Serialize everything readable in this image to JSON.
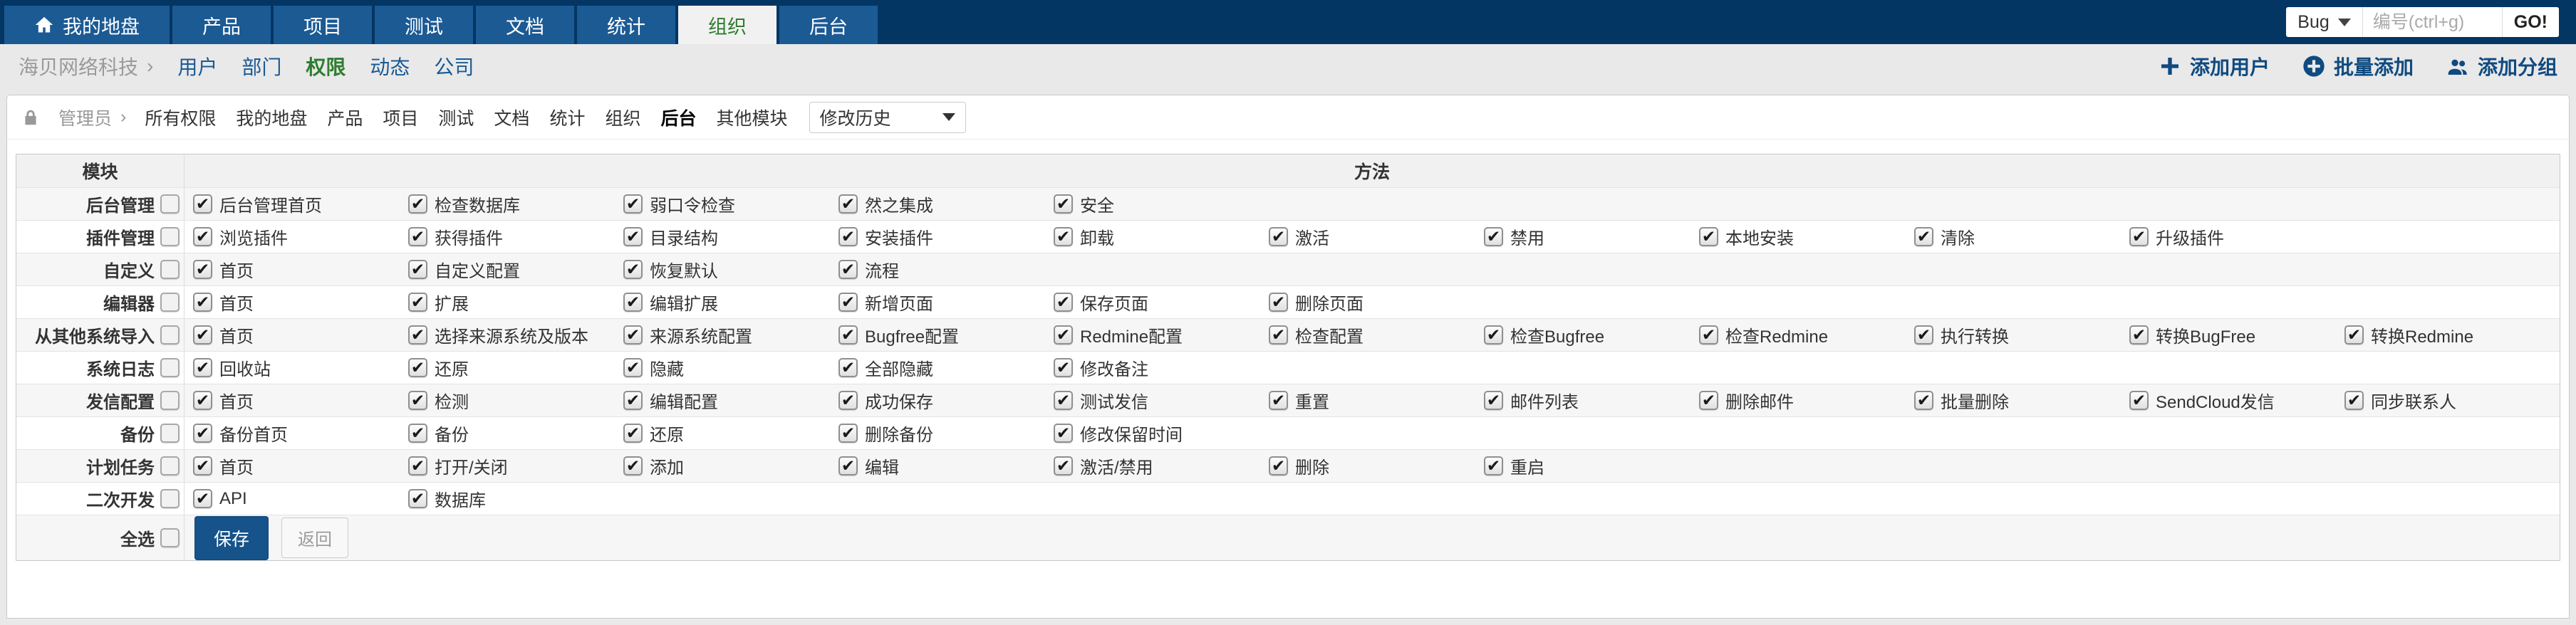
{
  "navbar": {
    "tabs": [
      {
        "id": "my-dashboard",
        "label": "我的地盘",
        "icon": "home",
        "active": false
      },
      {
        "id": "product",
        "label": "产品",
        "active": false
      },
      {
        "id": "project",
        "label": "项目",
        "active": false
      },
      {
        "id": "test",
        "label": "测试",
        "active": false
      },
      {
        "id": "doc",
        "label": "文档",
        "active": false
      },
      {
        "id": "stats",
        "label": "统计",
        "active": false
      },
      {
        "id": "organization",
        "label": "组织",
        "active": true
      },
      {
        "id": "admin",
        "label": "后台",
        "active": false
      }
    ],
    "search": {
      "category": "Bug",
      "placeholder": "编号(ctrl+g)",
      "go": "GO!"
    }
  },
  "submenu": {
    "company": "海贝网络科技",
    "separator": "›",
    "items": [
      {
        "id": "user",
        "label": "用户",
        "active": false
      },
      {
        "id": "dept",
        "label": "部门",
        "active": false
      },
      {
        "id": "privilege",
        "label": "权限",
        "active": true
      },
      {
        "id": "dynamic",
        "label": "动态",
        "active": false
      },
      {
        "id": "company",
        "label": "公司",
        "active": false
      }
    ],
    "actions": [
      {
        "id": "add-user",
        "icon": "plus",
        "label": "添加用户"
      },
      {
        "id": "batch-add",
        "icon": "plus-circle",
        "label": "批量添加"
      },
      {
        "id": "add-group",
        "icon": "users",
        "label": "添加分组"
      }
    ]
  },
  "toolbar": {
    "user": "管理员",
    "separator": "›",
    "links": [
      {
        "id": "all-priv",
        "label": "所有权限",
        "active": false
      },
      {
        "id": "my",
        "label": "我的地盘",
        "active": false
      },
      {
        "id": "product",
        "label": "产品",
        "active": false
      },
      {
        "id": "project",
        "label": "项目",
        "active": false
      },
      {
        "id": "test",
        "label": "测试",
        "active": false
      },
      {
        "id": "doc",
        "label": "文档",
        "active": false
      },
      {
        "id": "stats",
        "label": "统计",
        "active": false
      },
      {
        "id": "organization",
        "label": "组织",
        "active": false
      },
      {
        "id": "admin",
        "label": "后台",
        "active": true
      },
      {
        "id": "other",
        "label": "其他模块",
        "active": false
      }
    ],
    "history_select_value": "修改历史"
  },
  "table": {
    "module_header": "模块",
    "method_header": "方法",
    "rows": [
      {
        "module": "后台管理",
        "module_checked": false,
        "methods": [
          "后台管理首页",
          "检查数据库",
          "弱口令检查",
          "然之集成",
          "安全"
        ]
      },
      {
        "module": "插件管理",
        "module_checked": false,
        "methods": [
          "浏览插件",
          "获得插件",
          "目录结构",
          "安装插件",
          "卸载",
          "激活",
          "禁用",
          "本地安装",
          "清除",
          "升级插件"
        ]
      },
      {
        "module": "自定义",
        "module_checked": false,
        "methods": [
          "首页",
          "自定义配置",
          "恢复默认",
          "流程"
        ]
      },
      {
        "module": "编辑器",
        "module_checked": false,
        "methods": [
          "首页",
          "扩展",
          "编辑扩展",
          "新增页面",
          "保存页面",
          "删除页面"
        ]
      },
      {
        "module": "从其他系统导入",
        "module_checked": false,
        "methods": [
          "首页",
          "选择来源系统及版本",
          "来源系统配置",
          "Bugfree配置",
          "Redmine配置",
          "检查配置",
          "检查Bugfree",
          "检查Redmine",
          "执行转换",
          "转换BugFree",
          "转换Redmine"
        ]
      },
      {
        "module": "系统日志",
        "module_checked": false,
        "methods": [
          "回收站",
          "还原",
          "隐藏",
          "全部隐藏",
          "修改备注"
        ]
      },
      {
        "module": "发信配置",
        "module_checked": false,
        "methods": [
          "首页",
          "检测",
          "编辑配置",
          "成功保存",
          "测试发信",
          "重置",
          "邮件列表",
          "删除邮件",
          "批量删除",
          "SendCloud发信",
          "同步联系人"
        ]
      },
      {
        "module": "备份",
        "module_checked": false,
        "methods": [
          "备份首页",
          "备份",
          "还原",
          "删除备份",
          "修改保留时间"
        ]
      },
      {
        "module": "计划任务",
        "module_checked": false,
        "methods": [
          "首页",
          "打开/关闭",
          "添加",
          "编辑",
          "激活/禁用",
          "删除",
          "重启"
        ]
      },
      {
        "module": "二次开发",
        "module_checked": false,
        "methods": [
          "API",
          "数据库"
        ]
      }
    ],
    "all_methods_checked": true,
    "select_all_label": "全选",
    "select_all_checked": false,
    "save_label": "保存",
    "back_label": "返回"
  },
  "colors": {
    "navbar_bg": "#033663",
    "tab_bg": "#1c5a94",
    "active_tab_bg": "#f1f1f1",
    "active_green": "#2e7d2e",
    "link_blue": "#1a5a94",
    "action_navy": "#0f4a80",
    "save_button": "#15538a",
    "row_stripe": "#f6f6f6"
  }
}
